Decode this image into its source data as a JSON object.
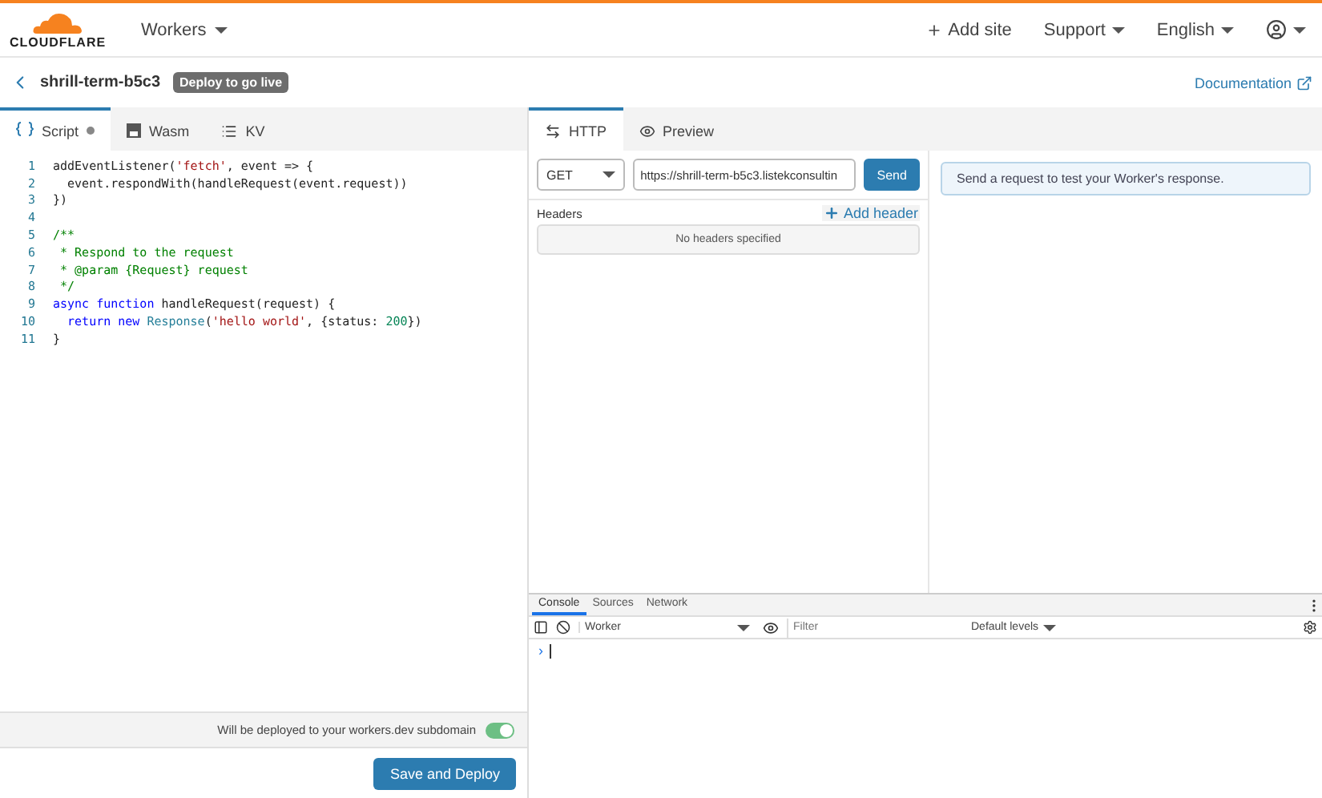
{
  "header": {
    "logo": "CLOUDFLARE",
    "product_menu": "Workers",
    "actions": [
      {
        "kind": "add",
        "label": "Add site"
      },
      {
        "kind": "menu",
        "label": "Support"
      },
      {
        "kind": "menu",
        "label": "English"
      },
      {
        "kind": "account"
      }
    ]
  },
  "subheader": {
    "worker_name": "shrill-term-b5c3",
    "badge": "Deploy to go live",
    "docs_link": "Documentation"
  },
  "editor_tabs": [
    {
      "kind": "script",
      "label": "Script",
      "selected": true,
      "modified": true
    },
    {
      "kind": "wasm",
      "label": "Wasm",
      "selected": false,
      "modified": false
    },
    {
      "kind": "kv",
      "label": "KV",
      "selected": false,
      "modified": false
    }
  ],
  "code_lines": [
    {
      "number": "1",
      "tokens": [
        {
          "kind": "plain",
          "text": "addEventListener("
        },
        {
          "kind": "string",
          "text": "'fetch'"
        },
        {
          "kind": "plain",
          "text": ", event => {"
        }
      ]
    },
    {
      "number": "2",
      "tokens": [
        {
          "kind": "plain",
          "text": "  event.respondWith(handleRequest(event.request))"
        }
      ]
    },
    {
      "number": "3",
      "tokens": [
        {
          "kind": "plain",
          "text": "})"
        }
      ]
    },
    {
      "number": "4"
    },
    {
      "number": "5",
      "tokens": [
        {
          "kind": "comment",
          "text": "/**"
        }
      ]
    },
    {
      "number": "6",
      "tokens": [
        {
          "kind": "comment",
          "text": " * Respond to the request"
        }
      ]
    },
    {
      "number": "7",
      "tokens": [
        {
          "kind": "comment",
          "text": " * @param {Request} request"
        }
      ]
    },
    {
      "number": "8",
      "tokens": [
        {
          "kind": "comment",
          "text": " */"
        }
      ]
    },
    {
      "number": "9",
      "tokens": [
        {
          "kind": "keyword",
          "text": "async function"
        },
        {
          "kind": "plain",
          "text": " handleRequest(request) {"
        }
      ]
    },
    {
      "number": "10",
      "tokens": [
        {
          "kind": "keyword",
          "text": "  return new"
        },
        {
          "kind": "type",
          "text": " Response"
        },
        {
          "kind": "plain",
          "text": "("
        },
        {
          "kind": "string",
          "text": "'hello world'"
        },
        {
          "kind": "plain",
          "text": ", {status: "
        },
        {
          "kind": "number",
          "text": "200"
        },
        {
          "kind": "plain",
          "text": "})"
        }
      ]
    },
    {
      "number": "11",
      "tokens": [
        {
          "kind": "plain",
          "text": "}"
        }
      ]
    }
  ],
  "deploy": {
    "note": "Will be deployed to your workers.dev subdomain",
    "toggle_on": true,
    "button": "Save and Deploy"
  },
  "preview_tabs": [
    {
      "kind": "http",
      "label": "HTTP",
      "selected": true
    },
    {
      "kind": "preview",
      "label": "Preview",
      "selected": false
    }
  ],
  "request": {
    "method": "GET",
    "url": "https://shrill-term-b5c3.listekconsultin",
    "send": "Send",
    "headers_label": "Headers",
    "add_header": "Add header",
    "empty_headers": "No headers specified",
    "response_hint": "Send a request to test your Worker's response."
  },
  "devtools": {
    "tabs": [
      {
        "label": "Console",
        "selected": true
      },
      {
        "label": "Sources",
        "selected": false
      },
      {
        "label": "Network",
        "selected": false
      }
    ],
    "context": "Worker",
    "filter_placeholder": "Filter",
    "levels": "Default levels",
    "prompt": "›"
  }
}
